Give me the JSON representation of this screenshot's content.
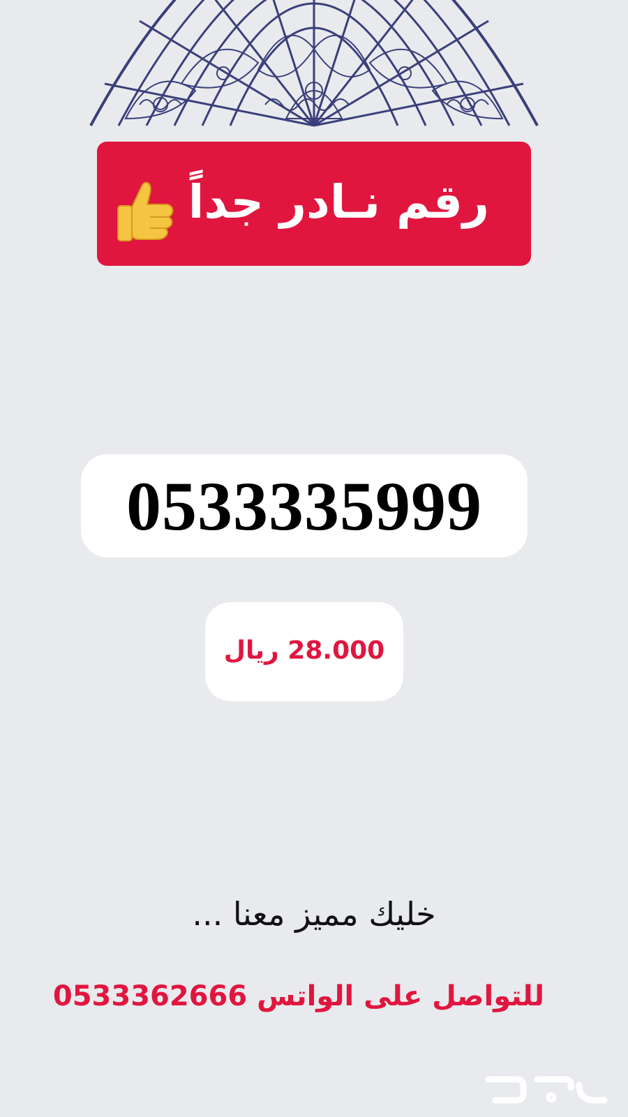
{
  "banner": {
    "title": "رقم نـادر جداً",
    "icon": "thumbs-up-icon"
  },
  "phone_number": "0533335999",
  "price": "28.000 ريال",
  "tagline": "خليك مميز معنا ...",
  "contact": "للتواصل على الواتس 0533362666",
  "decoration": {
    "mandala_color": "#3a3f7a",
    "accent": "#e0163f"
  },
  "watermark": {
    "icon": "haraj-logo-icon"
  }
}
